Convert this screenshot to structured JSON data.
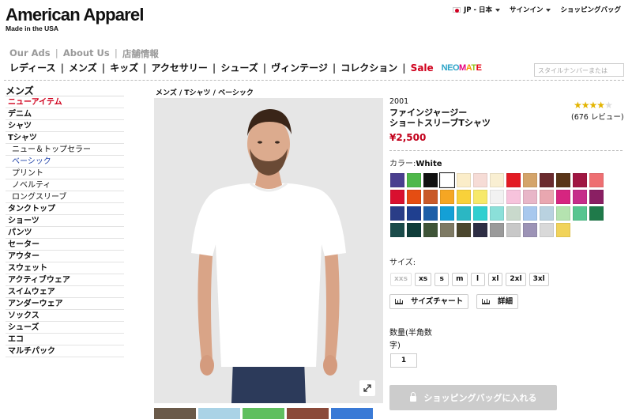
{
  "header": {
    "logo": "American Apparel",
    "tagline": "Made in the USA",
    "region": "JP - 日本",
    "signin": "サインイン",
    "bag": "ショッピングバッグ"
  },
  "sublinks": [
    "Our Ads",
    "About Us",
    "店舗情報"
  ],
  "nav": [
    "レディース",
    "メンズ",
    "キッズ",
    "アクセサリー",
    "シューズ",
    "ヴィンテージ",
    "コレクション",
    "Sale"
  ],
  "neomate": "NEOMATE",
  "search": {
    "placeholder": "スタイルナンバーまたは"
  },
  "sidebar": {
    "title": "メンズ",
    "items": [
      {
        "label": "ニューアイテム",
        "type": "red"
      },
      {
        "label": "デニム",
        "type": ""
      },
      {
        "label": "シャツ",
        "type": ""
      },
      {
        "label": "Tシャツ",
        "type": ""
      },
      {
        "label": "ニュー＆トップセラー",
        "type": "sub"
      },
      {
        "label": "ベーシック",
        "type": "sub active"
      },
      {
        "label": "プリント",
        "type": "sub"
      },
      {
        "label": "ノベルティ",
        "type": "sub"
      },
      {
        "label": "ロングスリーブ",
        "type": "sub"
      },
      {
        "label": "タンクトップ",
        "type": ""
      },
      {
        "label": "ショーツ",
        "type": ""
      },
      {
        "label": "パンツ",
        "type": ""
      },
      {
        "label": "セーター",
        "type": ""
      },
      {
        "label": "アウター",
        "type": ""
      },
      {
        "label": "スウェット",
        "type": ""
      },
      {
        "label": "アクティブウェア",
        "type": ""
      },
      {
        "label": "スイムウェア",
        "type": ""
      },
      {
        "label": "アンダーウェア",
        "type": ""
      },
      {
        "label": "ソックス",
        "type": ""
      },
      {
        "label": "シューズ",
        "type": ""
      },
      {
        "label": "エコ",
        "type": ""
      },
      {
        "label": "マルチパック",
        "type": ""
      }
    ]
  },
  "breadcrumb": "メンズ / Tシャツ / ベーシック",
  "product": {
    "code": "2001",
    "title_line1": "ファインジャージー",
    "title_line2": "ショートスリーブTシャツ",
    "rating_stars": 4,
    "reviews": "(676 レビュー)",
    "price": "¥2,500",
    "color_label": "カラー:",
    "color_value": "White",
    "size_label": "サイズ:",
    "sizes": [
      {
        "label": "xxs",
        "disabled": true
      },
      {
        "label": "xs",
        "disabled": false
      },
      {
        "label": "s",
        "disabled": false
      },
      {
        "label": "m",
        "disabled": false
      },
      {
        "label": "l",
        "disabled": false
      },
      {
        "label": "xl",
        "disabled": false
      },
      {
        "label": "2xl",
        "disabled": false
      },
      {
        "label": "3xl",
        "disabled": false
      }
    ],
    "size_chart": "サイズチャート",
    "details": "詳細",
    "qty_label": "数量(半角数字)",
    "qty_value": "1",
    "add_to_bag": "ショッピングバッグに入れる"
  },
  "swatches": [
    "#4a3f8f",
    "#4fb84a",
    "#111111",
    "#ffffff",
    "#fbedc9",
    "#f6dcd6",
    "#f9efd2",
    "#e31b23",
    "#d4a46a",
    "#6b2b2f",
    "#5a3518",
    "#a01642",
    "#ee6f72",
    "#d9102f",
    "#e54d12",
    "#c95a2a",
    "#f5a623",
    "#f8d13a",
    "#f7e96a",
    "#f2f2f2",
    "#f7c3dc",
    "#e8b6c8",
    "#e9a7b0",
    "#d62580",
    "#c62d8a",
    "#8a1f63",
    "#2a3d87",
    "#1f3f8f",
    "#1d5fa8",
    "#14a0d6",
    "#2bb7c3",
    "#30cfd0",
    "#8be0d9",
    "#c9d9cc",
    "#a8c8ee",
    "#b9d2e0",
    "#b5e3b0",
    "#57c590",
    "#1f7a4a",
    "#1a4b4a",
    "#0f3d3a",
    "#3f5538",
    "#7e7a64",
    "#4b472e",
    "#2e2e44",
    "#9a9a9a",
    "#c8c8c8",
    "#9c93b6",
    "#d9d9d9",
    "#f1d35a"
  ],
  "thumbs": [
    "#6a5a4a",
    "#aad3e6",
    "#5fbf5f",
    "#8a4a3a",
    "#3a7ad6"
  ]
}
